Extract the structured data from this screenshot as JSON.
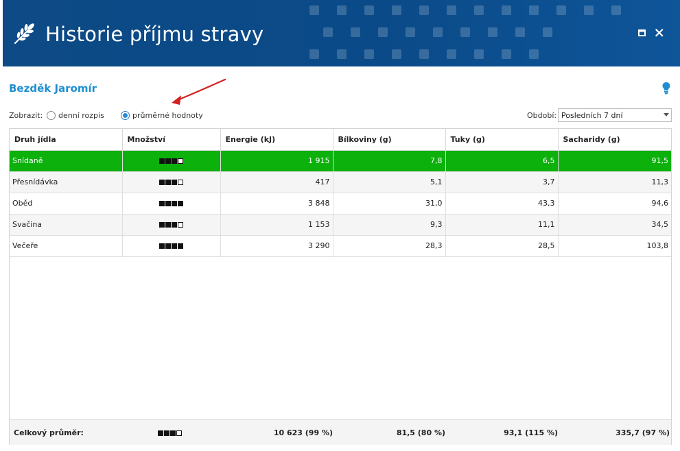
{
  "window": {
    "title": "Historie příjmu stravy"
  },
  "patient": {
    "name": "Bezděk Jaromír"
  },
  "display": {
    "label": "Zobrazit:",
    "options": [
      {
        "label": "denní rozpis",
        "checked": false
      },
      {
        "label": "průměrné hodnoty",
        "checked": true
      }
    ]
  },
  "period": {
    "label": "Období:",
    "selected": "Posledních 7 dní"
  },
  "table": {
    "columns": [
      "Druh jídla",
      "Množství",
      "Energie (kJ)",
      "Bílkoviny (g)",
      "Tuky (g)",
      "Sacharidy (g)"
    ],
    "rows": [
      {
        "meal": "Snídaně",
        "quantity": 3,
        "energy": "1 915",
        "protein": "7,8",
        "fat": "6,5",
        "carbs": "91,5",
        "selected": true
      },
      {
        "meal": "Přesnídávka",
        "quantity": 3,
        "energy": "417",
        "protein": "5,1",
        "fat": "3,7",
        "carbs": "11,3",
        "selected": false
      },
      {
        "meal": "Oběd",
        "quantity": 4,
        "energy": "3 848",
        "protein": "31,0",
        "fat": "43,3",
        "carbs": "94,6",
        "selected": false
      },
      {
        "meal": "Svačina",
        "quantity": 3,
        "energy": "1 153",
        "protein": "9,3",
        "fat": "11,1",
        "carbs": "34,5",
        "selected": false
      },
      {
        "meal": "Večeře",
        "quantity": 4,
        "energy": "3 290",
        "protein": "28,3",
        "fat": "28,5",
        "carbs": "103,8",
        "selected": false
      }
    ],
    "quantity_max": 4
  },
  "footer": {
    "label": "Celkový průměr:",
    "quantity": 3,
    "energy": "10 623  (99 %)",
    "protein": "81,5  (80 %)",
    "fat": "93,1  (115 %)",
    "carbs": "335,7  (97 %)"
  },
  "colors": {
    "header_bg": "#0b4a88",
    "accent": "#1f8fd0",
    "selected_row": "#0cb10c",
    "annotation_arrow": "#d42020"
  },
  "icons": {
    "logo": "wheat-icon",
    "maximize": "maximize-icon",
    "close": "close-icon",
    "hint": "lightbulb-icon",
    "dropdown": "chevron-down-icon"
  }
}
